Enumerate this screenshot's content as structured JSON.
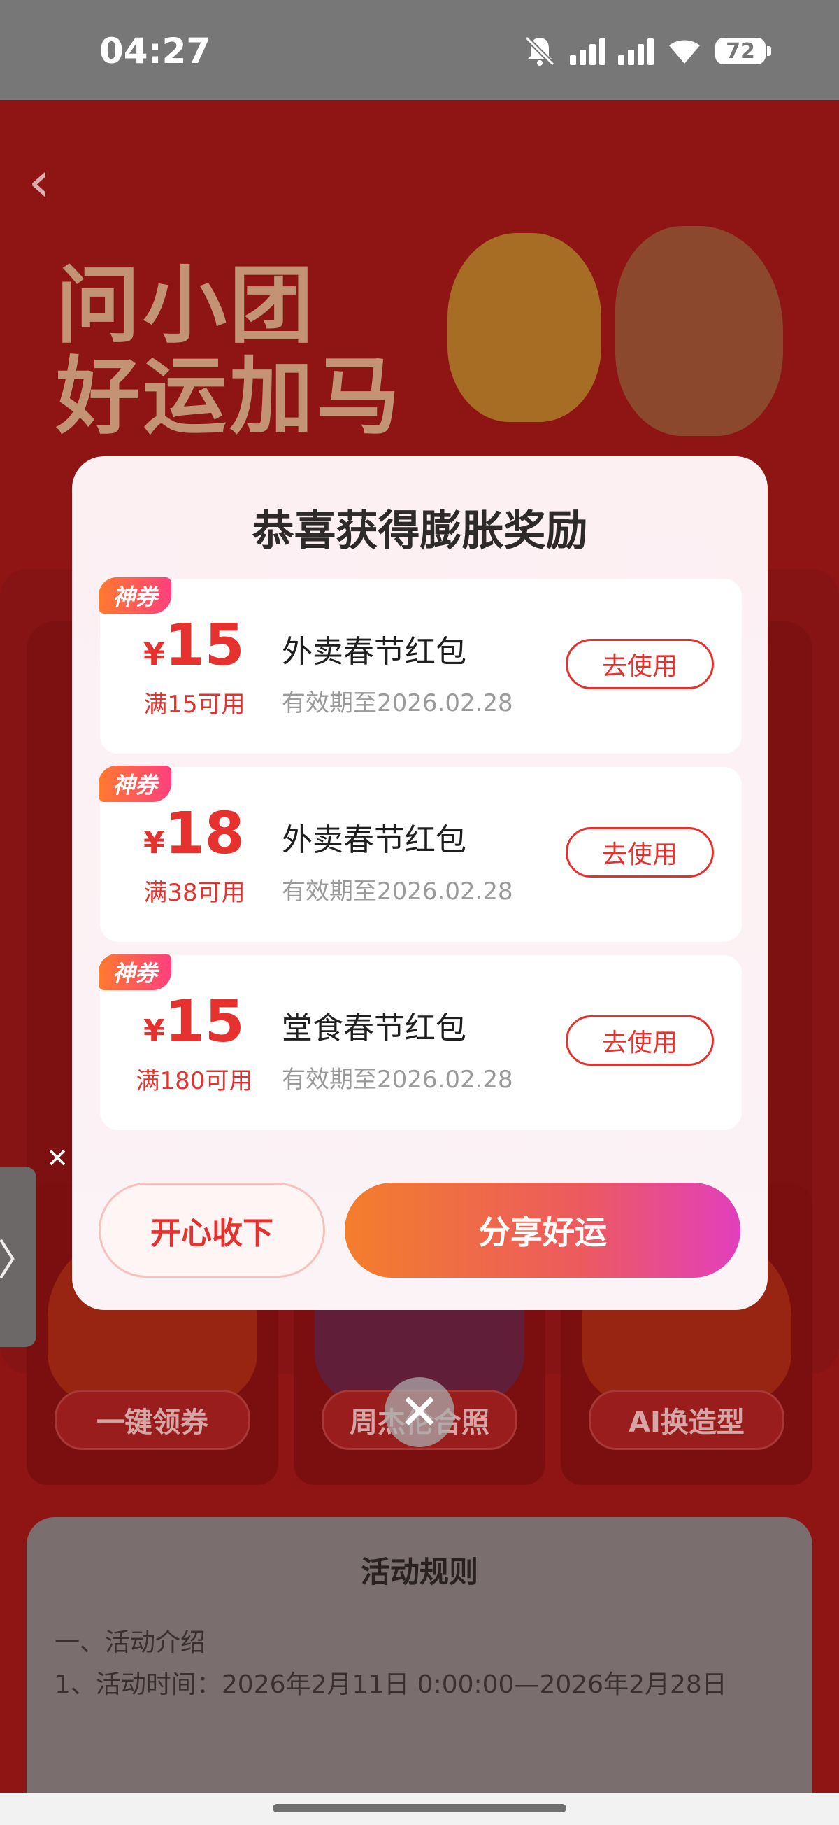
{
  "status_bar": {
    "time": "04:27",
    "battery": "72",
    "icons": [
      "mute-bell-icon",
      "signal-icon",
      "signal-icon",
      "wifi-icon",
      "battery-icon"
    ]
  },
  "background": {
    "back_icon": "chevron-left-icon",
    "hero_title_line1": "问小团",
    "hero_title_line2": "好运加马",
    "grid_buttons": [
      "一键领券",
      "周杰伦合照",
      "AI换造型"
    ],
    "rules_title": "活动规则",
    "rules_line1": "一、活动介绍",
    "rules_line2": "1、活动时间：2026年2月11日 0:00:00—2026年2月28日"
  },
  "side_tab": {
    "arrow": "〉",
    "close": "✕"
  },
  "modal": {
    "title": "恭喜获得膨胀奖励",
    "coupons": [
      {
        "badge": "神券",
        "currency": "¥",
        "amount": "15",
        "condition": "满15可用",
        "name": "外卖春节红包",
        "validity": "有效期至2026.02.28",
        "button": "去使用"
      },
      {
        "badge": "神券",
        "currency": "¥",
        "amount": "18",
        "condition": "满38可用",
        "name": "外卖春节红包",
        "validity": "有效期至2026.02.28",
        "button": "去使用"
      },
      {
        "badge": "神券",
        "currency": "¥",
        "amount": "15",
        "condition": "满180可用",
        "name": "堂食春节红包",
        "validity": "有效期至2026.02.28",
        "button": "去使用"
      }
    ],
    "accept_label": "开心收下",
    "share_label": "分享好运",
    "close": "✕"
  },
  "colors": {
    "accent_red": "#e5322e",
    "share_gradient_start": "#f37e2c",
    "share_gradient_end": "#e23fbd"
  }
}
